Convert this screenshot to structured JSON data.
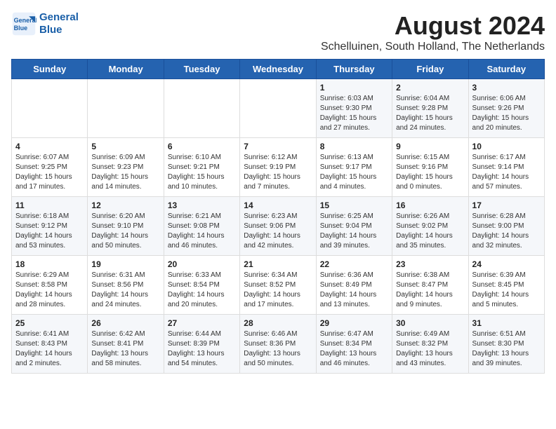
{
  "logo": {
    "line1": "General",
    "line2": "Blue"
  },
  "title": "August 2024",
  "location": "Schelluinen, South Holland, The Netherlands",
  "days_of_week": [
    "Sunday",
    "Monday",
    "Tuesday",
    "Wednesday",
    "Thursday",
    "Friday",
    "Saturday"
  ],
  "weeks": [
    [
      {
        "day": "",
        "content": ""
      },
      {
        "day": "",
        "content": ""
      },
      {
        "day": "",
        "content": ""
      },
      {
        "day": "",
        "content": ""
      },
      {
        "day": "1",
        "content": "Sunrise: 6:03 AM\nSunset: 9:30 PM\nDaylight: 15 hours and 27 minutes."
      },
      {
        "day": "2",
        "content": "Sunrise: 6:04 AM\nSunset: 9:28 PM\nDaylight: 15 hours and 24 minutes."
      },
      {
        "day": "3",
        "content": "Sunrise: 6:06 AM\nSunset: 9:26 PM\nDaylight: 15 hours and 20 minutes."
      }
    ],
    [
      {
        "day": "4",
        "content": "Sunrise: 6:07 AM\nSunset: 9:25 PM\nDaylight: 15 hours and 17 minutes."
      },
      {
        "day": "5",
        "content": "Sunrise: 6:09 AM\nSunset: 9:23 PM\nDaylight: 15 hours and 14 minutes."
      },
      {
        "day": "6",
        "content": "Sunrise: 6:10 AM\nSunset: 9:21 PM\nDaylight: 15 hours and 10 minutes."
      },
      {
        "day": "7",
        "content": "Sunrise: 6:12 AM\nSunset: 9:19 PM\nDaylight: 15 hours and 7 minutes."
      },
      {
        "day": "8",
        "content": "Sunrise: 6:13 AM\nSunset: 9:17 PM\nDaylight: 15 hours and 4 minutes."
      },
      {
        "day": "9",
        "content": "Sunrise: 6:15 AM\nSunset: 9:16 PM\nDaylight: 15 hours and 0 minutes."
      },
      {
        "day": "10",
        "content": "Sunrise: 6:17 AM\nSunset: 9:14 PM\nDaylight: 14 hours and 57 minutes."
      }
    ],
    [
      {
        "day": "11",
        "content": "Sunrise: 6:18 AM\nSunset: 9:12 PM\nDaylight: 14 hours and 53 minutes."
      },
      {
        "day": "12",
        "content": "Sunrise: 6:20 AM\nSunset: 9:10 PM\nDaylight: 14 hours and 50 minutes."
      },
      {
        "day": "13",
        "content": "Sunrise: 6:21 AM\nSunset: 9:08 PM\nDaylight: 14 hours and 46 minutes."
      },
      {
        "day": "14",
        "content": "Sunrise: 6:23 AM\nSunset: 9:06 PM\nDaylight: 14 hours and 42 minutes."
      },
      {
        "day": "15",
        "content": "Sunrise: 6:25 AM\nSunset: 9:04 PM\nDaylight: 14 hours and 39 minutes."
      },
      {
        "day": "16",
        "content": "Sunrise: 6:26 AM\nSunset: 9:02 PM\nDaylight: 14 hours and 35 minutes."
      },
      {
        "day": "17",
        "content": "Sunrise: 6:28 AM\nSunset: 9:00 PM\nDaylight: 14 hours and 32 minutes."
      }
    ],
    [
      {
        "day": "18",
        "content": "Sunrise: 6:29 AM\nSunset: 8:58 PM\nDaylight: 14 hours and 28 minutes."
      },
      {
        "day": "19",
        "content": "Sunrise: 6:31 AM\nSunset: 8:56 PM\nDaylight: 14 hours and 24 minutes."
      },
      {
        "day": "20",
        "content": "Sunrise: 6:33 AM\nSunset: 8:54 PM\nDaylight: 14 hours and 20 minutes."
      },
      {
        "day": "21",
        "content": "Sunrise: 6:34 AM\nSunset: 8:52 PM\nDaylight: 14 hours and 17 minutes."
      },
      {
        "day": "22",
        "content": "Sunrise: 6:36 AM\nSunset: 8:49 PM\nDaylight: 14 hours and 13 minutes."
      },
      {
        "day": "23",
        "content": "Sunrise: 6:38 AM\nSunset: 8:47 PM\nDaylight: 14 hours and 9 minutes."
      },
      {
        "day": "24",
        "content": "Sunrise: 6:39 AM\nSunset: 8:45 PM\nDaylight: 14 hours and 5 minutes."
      }
    ],
    [
      {
        "day": "25",
        "content": "Sunrise: 6:41 AM\nSunset: 8:43 PM\nDaylight: 14 hours and 2 minutes."
      },
      {
        "day": "26",
        "content": "Sunrise: 6:42 AM\nSunset: 8:41 PM\nDaylight: 13 hours and 58 minutes."
      },
      {
        "day": "27",
        "content": "Sunrise: 6:44 AM\nSunset: 8:39 PM\nDaylight: 13 hours and 54 minutes."
      },
      {
        "day": "28",
        "content": "Sunrise: 6:46 AM\nSunset: 8:36 PM\nDaylight: 13 hours and 50 minutes."
      },
      {
        "day": "29",
        "content": "Sunrise: 6:47 AM\nSunset: 8:34 PM\nDaylight: 13 hours and 46 minutes."
      },
      {
        "day": "30",
        "content": "Sunrise: 6:49 AM\nSunset: 8:32 PM\nDaylight: 13 hours and 43 minutes."
      },
      {
        "day": "31",
        "content": "Sunrise: 6:51 AM\nSunset: 8:30 PM\nDaylight: 13 hours and 39 minutes."
      }
    ]
  ]
}
